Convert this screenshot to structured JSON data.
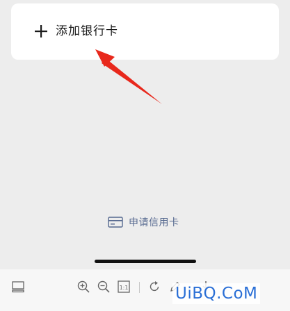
{
  "add_card": {
    "label": "添加银行卡",
    "icon": "plus-icon"
  },
  "apply_credit": {
    "label": "申请信用卡",
    "icon": "credit-card-icon",
    "color": "#55688f"
  },
  "annotation": {
    "arrow_color": "#e8281c"
  },
  "toolbar": {
    "icons": [
      "layout-icon",
      "zoom-in-icon",
      "zoom-out-icon",
      "actual-size-icon",
      "rotate-icon",
      "edit-icon",
      "download-icon"
    ],
    "actual_size_label": "1:1"
  },
  "watermark": {
    "text": "UiBQ.CoM",
    "color": "#2a6fd6"
  }
}
